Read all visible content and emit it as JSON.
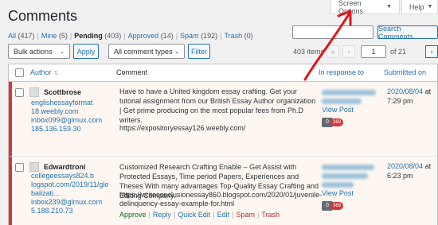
{
  "page_title": "Comments",
  "top_tabs": {
    "screen_options": "Screen Options",
    "help": "Help"
  },
  "filters": {
    "all": "All",
    "all_count": "(417)",
    "mine": "Mine",
    "mine_count": "(5)",
    "pending": "Pending",
    "pending_count": "(403)",
    "approved": "Approved",
    "approved_count": "(14)",
    "spam": "Spam",
    "spam_count": "(192)",
    "trash": "Trash",
    "trash_count": "(0)"
  },
  "search": {
    "placeholder": "",
    "button": "Search Comments"
  },
  "actions": {
    "bulk": "Bulk actions",
    "apply": "Apply",
    "type": "All comment types",
    "filter": "Filter"
  },
  "pagination": {
    "items": "403 items",
    "first": "«",
    "prev": "‹",
    "current": "1",
    "of": "of 21",
    "next": "›"
  },
  "columns": {
    "author": "Author",
    "comment": "Comment",
    "in_response_to": "In response to",
    "submitted_on": "Submitted on"
  },
  "comments": [
    {
      "author": "Scottbrose",
      "url_lines": [
        "englishessayformat",
        "18.weebly.com"
      ],
      "email": "inbox099@glmux.com",
      "ip": "185.136.159.30",
      "text": "Have to have a United kingdom essay crafting. Get your tutorial assignment from our British Essay Author organization | Get prime producing on the most popular fees from Ph.D writers.",
      "link": "https://expositoryessay126.weebly.com/",
      "view_post": "View Post",
      "count": "0",
      "pending": "369",
      "date": "2020/08/04",
      "at": "at",
      "time": "7:29 pm"
    },
    {
      "author": "Edwardtroni",
      "url_lines": [
        "collegeessays824.b",
        "logspot.com/2019/11/glo",
        "balizati..."
      ],
      "email": "inbox239@glmux.com",
      "ip": "5.188.210.73",
      "text": "Customized Research Crafting Enable – Get Assist with Protected Essays, Time period Papers, Experiences and Theses With many advantages Top-Quality Essay Crafting and Editing Company.",
      "link": "https://writeconclusionessay860.blogspot.com/2020/01/juvenile-delinquency-essay-example-for.html",
      "link_lines": [
        "https://writeconclusionessay860.blogspot.com/2020/01/juvenile-",
        "delinquency-essay-example-for.html"
      ],
      "view_post": "View Post",
      "count": "0",
      "pending": "369",
      "date": "2020/08/04",
      "at": "at",
      "time": "6:23 pm",
      "row_actions": {
        "approve": "Approve",
        "reply": "Reply",
        "quick_edit": "Quick Edit",
        "edit": "Edit",
        "spam": "Spam",
        "trash": "Trash",
        "sep": "|"
      }
    }
  ],
  "colors": {
    "accent": "#2271b1",
    "pending_row": "#fef7f1",
    "unapproved_border": "#d63638",
    "arrow": "#e0141b"
  }
}
